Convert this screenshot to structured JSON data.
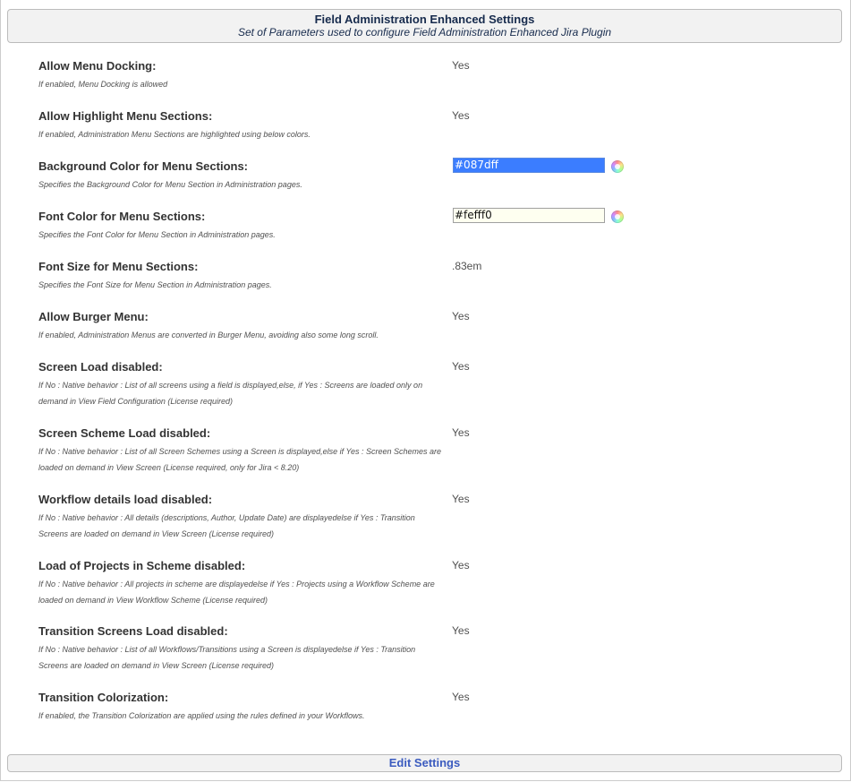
{
  "header": {
    "title": "Field Administration Enhanced Settings",
    "subtitle": "Set of Parameters used to configure Field Administration Enhanced Jira Plugin"
  },
  "settings": [
    {
      "label": "Allow Menu Docking:",
      "description": "If enabled, Menu Docking is allowed",
      "value": "Yes"
    },
    {
      "label": "Allow Highlight Menu Sections:",
      "description": "If enabled, Administration Menu Sections are highlighted using below colors.",
      "value": "Yes"
    },
    {
      "label": "Background Color for Menu Sections:",
      "description": "Specifies the Background Color for Menu Section in Administration pages.",
      "value": "#087dff"
    },
    {
      "label": "Font Color for Menu Sections:",
      "description": "Specifies the Font Color for Menu Section in Administration pages.",
      "value": "#fefff0"
    },
    {
      "label": "Font Size for Menu Sections:",
      "description": "Specifies the Font Size for Menu Section in Administration pages.",
      "value": ".83em"
    },
    {
      "label": "Allow Burger Menu:",
      "description": "If enabled, Administration Menus are converted in Burger Menu, avoiding also some long scroll.",
      "value": "Yes"
    },
    {
      "label": "Screen Load disabled:",
      "description": "If No : Native behavior : List of all screens using a field is displayed,else, if Yes : Screens are loaded only on demand in View Field Configuration (License required)",
      "value": "Yes"
    },
    {
      "label": "Screen Scheme Load disabled:",
      "description": "If No : Native behavior : List of all Screen Schemes using a Screen is displayed,else if Yes : Screen Schemes are loaded on demand in View Screen (License required, only for Jira < 8.20)",
      "value": "Yes"
    },
    {
      "label": "Workflow details load disabled:",
      "description": "If No : Native behavior : All details (descriptions, Author, Update Date) are displayedelse if Yes : Transition Screens are loaded on demand in View Screen (License required)",
      "value": "Yes"
    },
    {
      "label": "Load of Projects in Scheme disabled:",
      "description": "If No : Native behavior : All projects in scheme are displayedelse if Yes : Projects using a Workflow Scheme are loaded on demand in View Workflow Scheme (License required)",
      "value": "Yes"
    },
    {
      "label": "Transition Screens Load disabled:",
      "description": "If No : Native behavior : List of all Workflows/Transitions using a Screen is displayedelse if Yes : Transition Screens are loaded on demand in View Screen (License required)",
      "value": "Yes"
    },
    {
      "label": "Transition Colorization:",
      "description": "If enabled, the Transition Colorization are applied using the rules defined in your Workflows.",
      "value": "Yes"
    }
  ],
  "footer": {
    "edit_label": "Edit Settings"
  },
  "colors": {
    "section_background_input": "#3b7dff",
    "font_color_input": "#fefff0",
    "link": "#3b5bbf"
  },
  "icons": {
    "color_picker": "color-wheel-icon"
  }
}
